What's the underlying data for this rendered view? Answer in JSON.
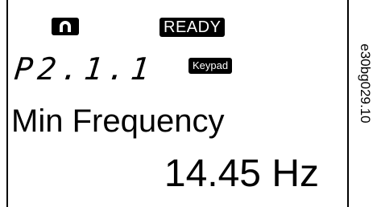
{
  "status": {
    "icon": "remote-control-icon",
    "state_label": "READY"
  },
  "parameter": {
    "code": "P2.1.1",
    "source_label": "Keypad",
    "name": "Min Frequency",
    "value": "14.45 Hz"
  },
  "figure_code": "e30bg029.10"
}
